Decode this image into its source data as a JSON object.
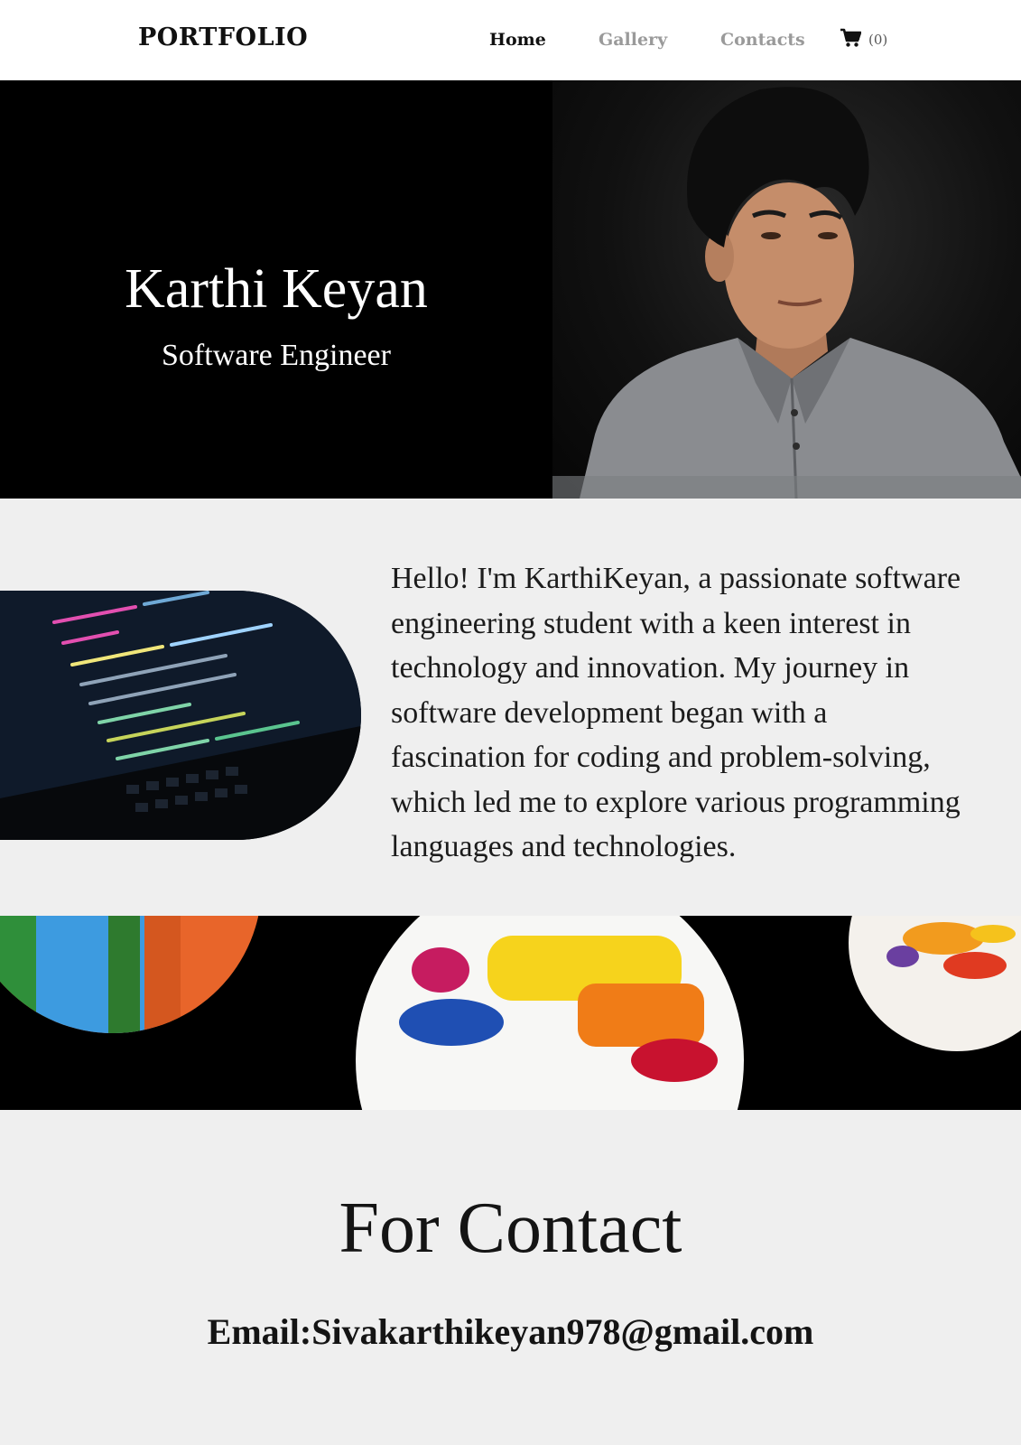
{
  "header": {
    "brand": "PORTFOLIO",
    "nav": [
      {
        "label": "Home",
        "active": true
      },
      {
        "label": "Gallery",
        "active": false
      },
      {
        "label": "Contacts",
        "active": false
      }
    ],
    "cart": {
      "icon": "cart-icon",
      "count": "(0)"
    }
  },
  "hero": {
    "name": "Karthi Keyan",
    "role": "Software Engineer",
    "photo": "portrait-photo"
  },
  "about": {
    "image": "code-laptop-image",
    "lines": [
      "Hello! I'm KarthiKeyan, a passionate software",
      "engineering student with a keen interest in",
      "technology and innovation. My journey in",
      "software development began with a",
      "fascination for coding and problem-solving,",
      "which led me to explore various programming",
      "languages and technologies."
    ]
  },
  "art_strip": {
    "image": "paint-swatch-circles"
  },
  "contact": {
    "title": "For Contact",
    "email": "Email:Sivakarthikeyan978@gmail.com"
  },
  "colors": {
    "page_bg": "#efefef",
    "header_bg": "#ffffff",
    "hero_bg": "#000000",
    "nav_active": "#111111",
    "nav_inactive": "#9a9a9a"
  }
}
